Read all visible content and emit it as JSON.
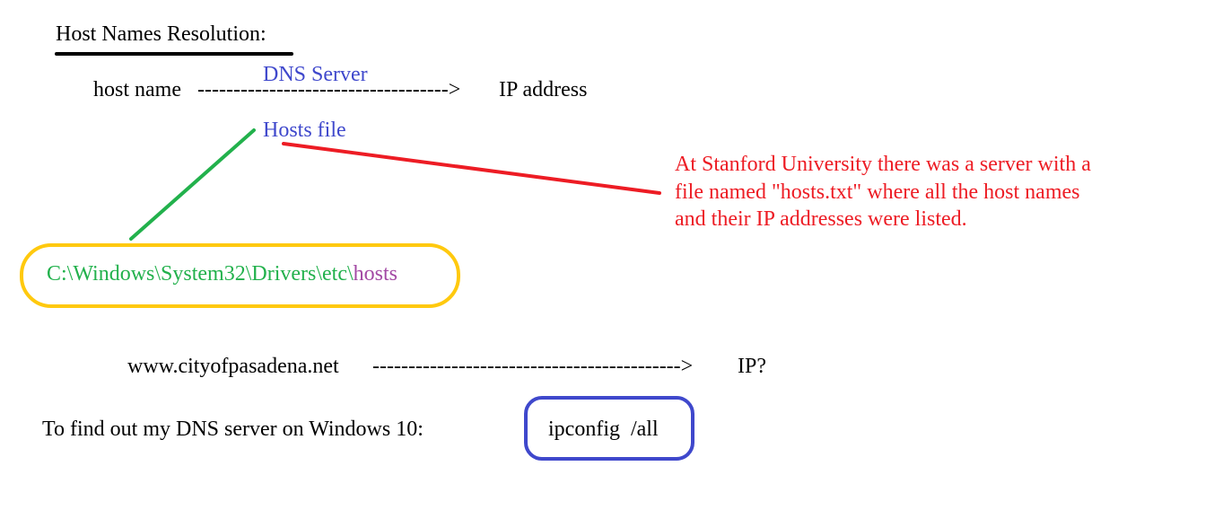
{
  "title": "Host Names Resolution:",
  "resolution": {
    "host_name": "host name",
    "arrow": "----------------------------------->",
    "ip_address": "IP address",
    "dns_server": "DNS Server",
    "hosts_file": "Hosts file"
  },
  "stanford_note": "At Stanford University there was a server with a\nfile named \"hosts.txt\" where all the host names\nand their IP addresses were listed.",
  "hosts_path": {
    "prefix": "C:\\Windows\\System32\\Drivers\\etc\\",
    "file": "hosts"
  },
  "example": {
    "host": "www.cityofpasadena.net",
    "arrow": "------------------------------------------->",
    "result": "IP?"
  },
  "dns_lookup": {
    "question": "To find out my DNS server on Windows 10:",
    "command": "ipconfig  /all"
  },
  "colors": {
    "underline": "#000000",
    "blue": "#3f48cc",
    "green": "#22b14c",
    "red": "#ed1c24",
    "purple": "#a349a4",
    "yellow": "#ffc90e"
  }
}
